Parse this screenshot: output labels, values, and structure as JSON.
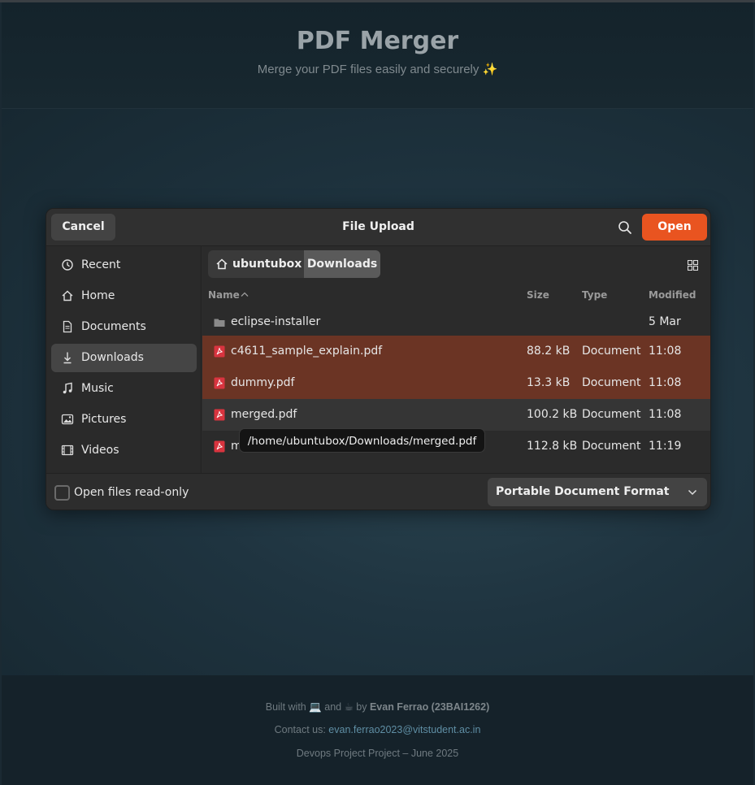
{
  "page": {
    "title": "PDF Merger",
    "subtitle": "Merge your PDF files easily and securely ✨"
  },
  "footer": {
    "built_prefix": "Built with 💻 and ☕ by ",
    "author": "Evan Ferrao (23BAI1262)",
    "contact_prefix": "Contact us: ",
    "contact_email": "evan.ferrao2023@vitstudent.ac.in",
    "project": "Devops Project Project – June 2025"
  },
  "dialog": {
    "cancel_label": "Cancel",
    "title": "File Upload",
    "open_label": "Open",
    "sidebar": [
      {
        "label": "Recent",
        "icon": "clock-icon"
      },
      {
        "label": "Home",
        "icon": "home-icon"
      },
      {
        "label": "Documents",
        "icon": "document-icon"
      },
      {
        "label": "Downloads",
        "icon": "download-icon",
        "active": true
      },
      {
        "label": "Music",
        "icon": "music-icon"
      },
      {
        "label": "Pictures",
        "icon": "picture-icon"
      },
      {
        "label": "Videos",
        "icon": "video-icon"
      }
    ],
    "breadcrumb": [
      "ubuntubox",
      "Downloads"
    ],
    "columns": {
      "name": "Name",
      "size": "Size",
      "type": "Type",
      "modified": "Modified"
    },
    "files": [
      {
        "name": "eclipse-installer",
        "size": "",
        "type": "",
        "modified": "5 Mar",
        "kind": "folder"
      },
      {
        "name": "c4611_sample_explain.pdf",
        "size": "88.2 kB",
        "type": "Document",
        "modified": "11:08",
        "kind": "pdf",
        "selected": true
      },
      {
        "name": "dummy.pdf",
        "size": "13.3 kB",
        "type": "Document",
        "modified": "11:08",
        "kind": "pdf",
        "selected": true
      },
      {
        "name": "merged.pdf",
        "size": "100.2 kB",
        "type": "Document",
        "modified": "11:08",
        "kind": "pdf"
      },
      {
        "name": "merged-1.pdf",
        "size": "112.8 kB",
        "type": "Document",
        "modified": "11:19",
        "kind": "pdf"
      }
    ],
    "tooltip": "/home/ubuntubox/Downloads/merged.pdf",
    "readonly_label": "Open files read-only",
    "filter_label": "Portable Document Format (PDF)",
    "colors": {
      "accent": "#e95420",
      "selected_row": "#6b3424"
    }
  }
}
